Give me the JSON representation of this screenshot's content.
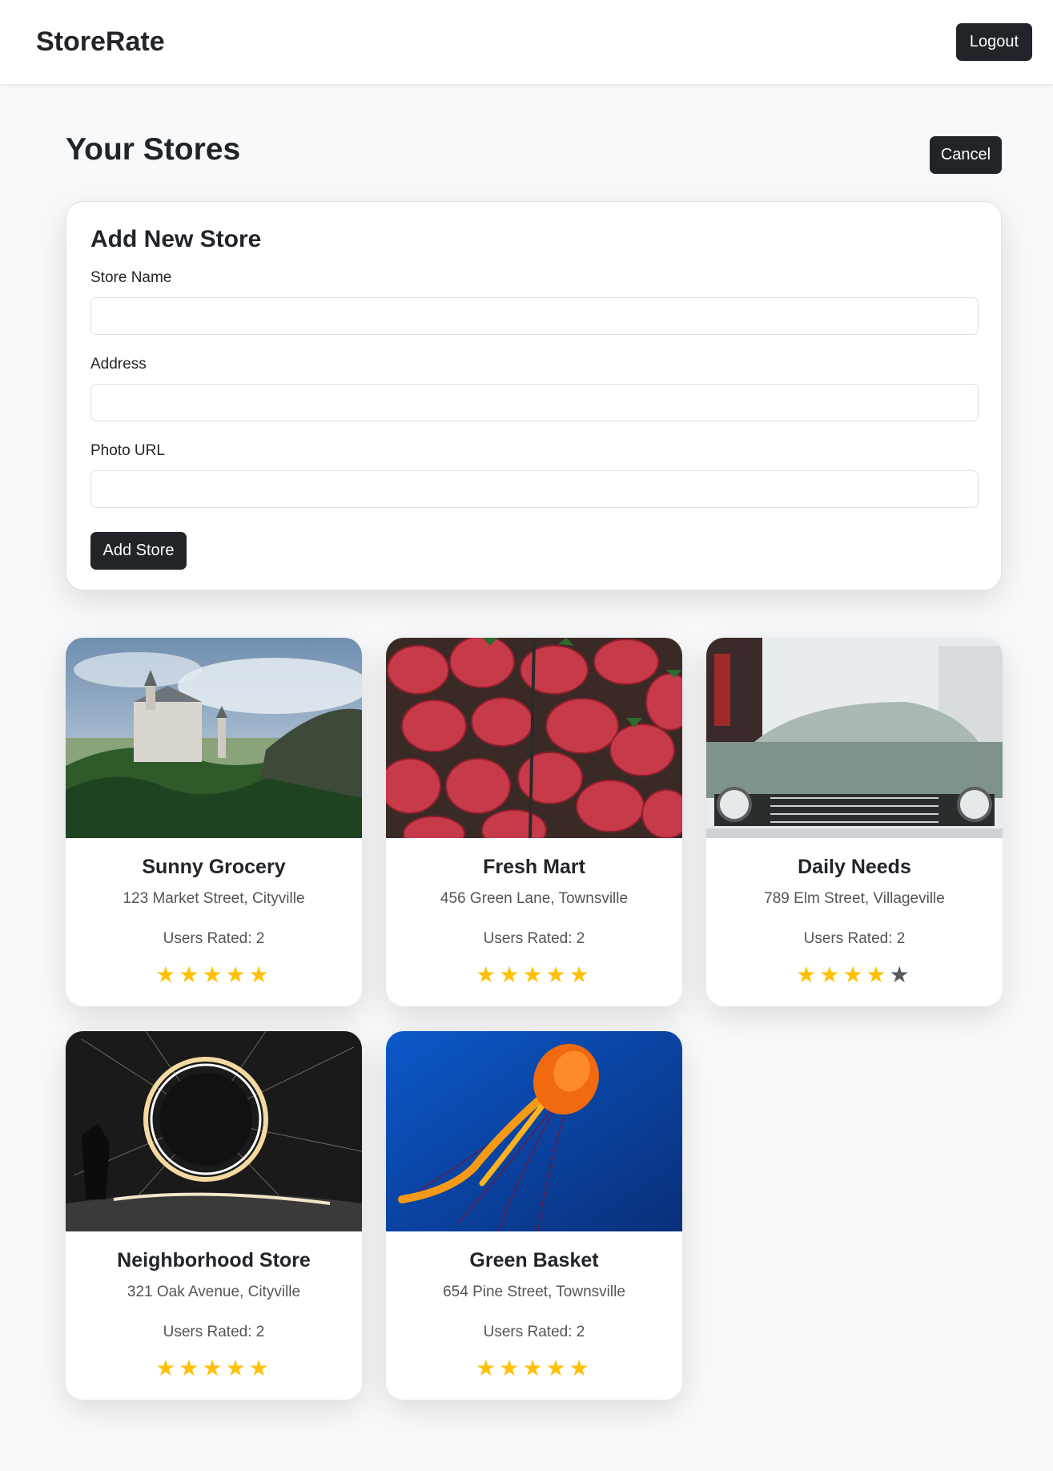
{
  "navbar": {
    "brand": "StoreRate",
    "logout_label": "Logout"
  },
  "page": {
    "title": "Your Stores",
    "cancel_label": "Cancel"
  },
  "form": {
    "title": "Add New Store",
    "fields": [
      {
        "label": "Store Name",
        "value": "",
        "placeholder": ""
      },
      {
        "label": "Address",
        "value": "",
        "placeholder": ""
      },
      {
        "label": "Photo URL",
        "value": "",
        "placeholder": ""
      }
    ],
    "submit_label": "Add Store"
  },
  "stores": [
    {
      "name": "Sunny Grocery",
      "address": "123 Market Street, Cityville",
      "rated_label": "Users Rated: 2",
      "rating": 5,
      "photo": "castle-on-forested-hill-image"
    },
    {
      "name": "Fresh Mart",
      "address": "456 Green Lane, Townsville",
      "rated_label": "Users Rated: 2",
      "rating": 5,
      "photo": "strawberries-image"
    },
    {
      "name": "Daily Needs",
      "address": "789 Elm Street, Villageville",
      "rated_label": "Users Rated: 2",
      "rating": 4,
      "photo": "vintage-car-front-image"
    },
    {
      "name": "Neighborhood Store",
      "address": "321 Oak Avenue, Cityville",
      "rated_label": "Users Rated: 2",
      "rating": 5,
      "photo": "steel-wool-light-ring-image"
    },
    {
      "name": "Green Basket",
      "address": "654 Pine Street, Townsville",
      "rated_label": "Users Rated: 2",
      "rating": 5,
      "photo": "orange-jellyfish-image"
    }
  ],
  "colors": {
    "star_filled": "#ffc107",
    "star_empty": "#555b61",
    "button_dark": "#212529",
    "background": "#f8f9fa"
  }
}
